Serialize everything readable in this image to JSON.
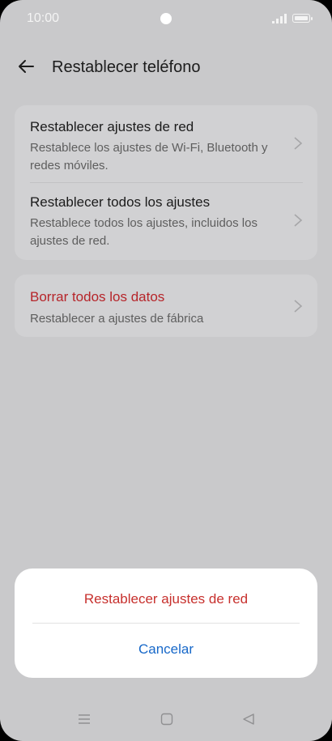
{
  "status_bar": {
    "time": "10:00"
  },
  "header": {
    "title": "Restablecer teléfono"
  },
  "reset_options": [
    {
      "title": "Restablecer ajustes de red",
      "subtitle": "Restablece los ajustes de Wi-Fi, Bluetooth y redes móviles."
    },
    {
      "title": "Restablecer todos los ajustes",
      "subtitle": "Restablece todos los ajustes, incluidos los ajustes de red."
    }
  ],
  "erase": {
    "title": "Borrar todos los datos",
    "subtitle": "Restablecer a ajustes de fábrica"
  },
  "sheet": {
    "confirm_label": "Restablecer ajustes de red",
    "cancel_label": "Cancelar"
  },
  "colors": {
    "destructive": "#c7302d",
    "link": "#1768c9",
    "erase_title": "#b6252a"
  },
  "icons": {
    "back": "arrow-left-icon",
    "chevron": "chevron-right-icon",
    "nav": [
      "menu-icon",
      "home-icon",
      "back-triangle-icon"
    ]
  }
}
